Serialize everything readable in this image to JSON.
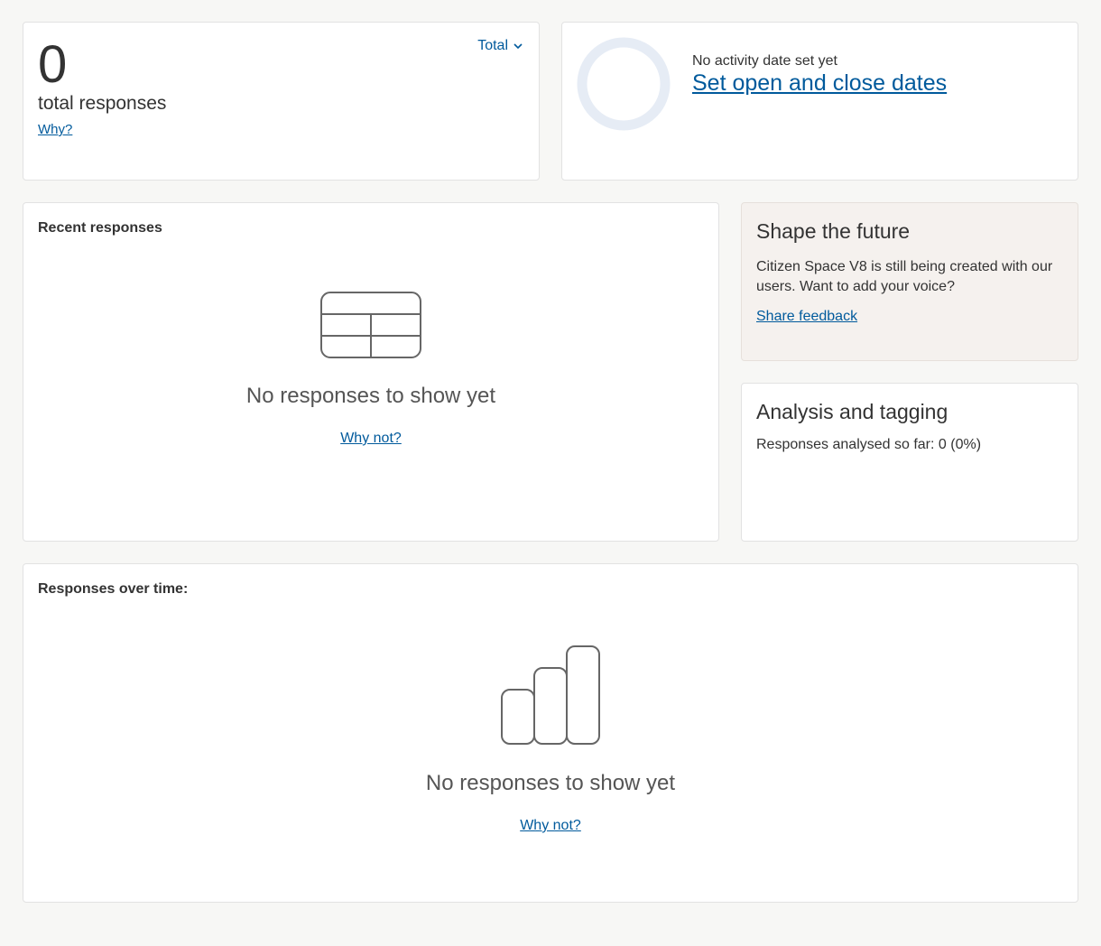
{
  "summary": {
    "total_count": "0",
    "total_label": "total responses",
    "why_link": "Why?",
    "filter_label": "Total"
  },
  "activity": {
    "status_text": "No activity date set yet",
    "set_dates_link": "Set open and close dates"
  },
  "recent": {
    "heading": "Recent responses",
    "empty_title": "No responses to show yet",
    "why_not_link": "Why not?"
  },
  "shape_future": {
    "title": "Shape the future",
    "body": "Citizen Space V8 is still being created with our users. Want to add your voice?",
    "link": "Share feedback"
  },
  "analysis": {
    "title": "Analysis and tagging",
    "progress_text": "Responses analysed so far: 0 (0%)"
  },
  "over_time": {
    "heading": "Responses over time:",
    "empty_title": "No responses to show yet",
    "why_not_link": "Why not?"
  },
  "colors": {
    "link": "#005a9c",
    "ring": "#e6ecf5",
    "tinted_card": "#f5f1ee",
    "icon_stroke": "#666666"
  }
}
